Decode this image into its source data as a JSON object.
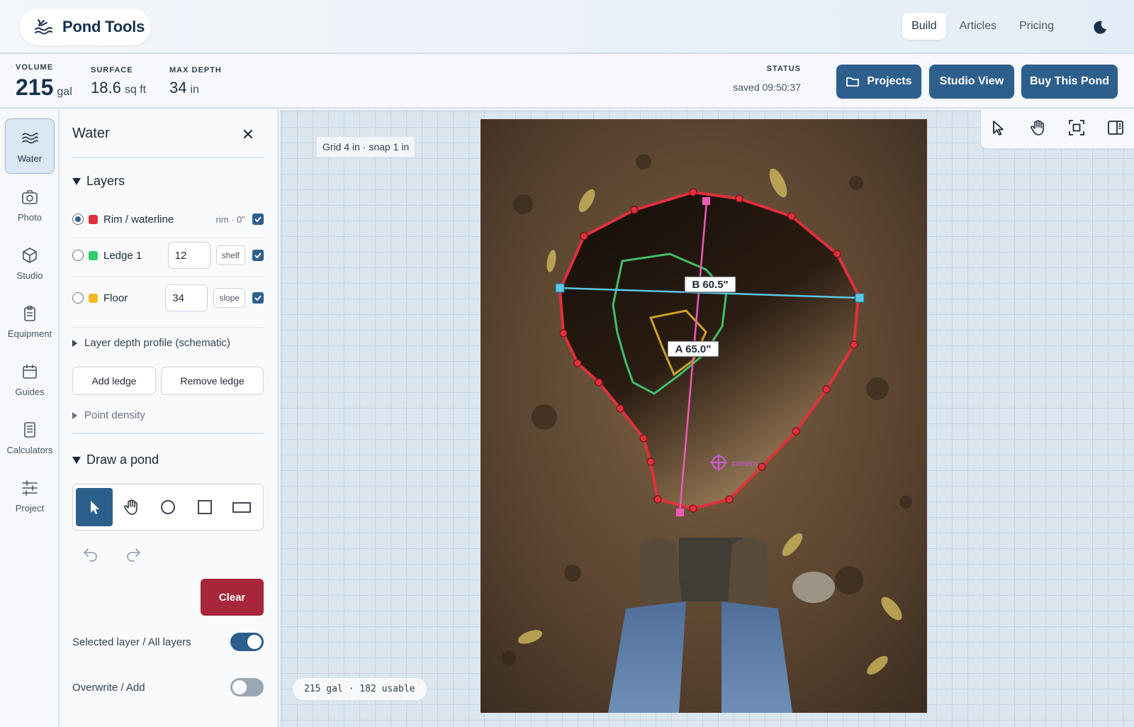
{
  "brand": {
    "name": "Pond Tools",
    "icon": "pond-waves-logo"
  },
  "nav": {
    "items": [
      "Build",
      "Articles",
      "Pricing"
    ],
    "active": "Build",
    "theme_icon": "moon-icon"
  },
  "stats": {
    "volume": {
      "label": "VOLUME",
      "value": "215",
      "unit": "gal"
    },
    "surface": {
      "label": "SURFACE",
      "value": "18.6",
      "unit": "sq ft"
    },
    "max_depth": {
      "label": "MAX DEPTH",
      "value": "34",
      "unit": "in"
    },
    "status": {
      "label": "STATUS",
      "value": "saved 09:50:37"
    }
  },
  "actions": {
    "projects": "Projects",
    "studio": "Studio View",
    "buy": "Buy This Pond"
  },
  "rail": [
    {
      "label": "Water",
      "icon": "waves-icon"
    },
    {
      "label": "Photo",
      "icon": "camera-icon"
    },
    {
      "label": "Studio",
      "icon": "cube-icon"
    },
    {
      "label": "Equipment",
      "icon": "clipboard-icon"
    },
    {
      "label": "Guides",
      "icon": "calendar-icon"
    },
    {
      "label": "Calculators",
      "icon": "calculator-icon"
    },
    {
      "label": "Project",
      "icon": "sliders-icon"
    }
  ],
  "panel": {
    "title": "Water",
    "layers_heading": "Layers",
    "layers": [
      {
        "name": "Rim / waterline",
        "color": "#e0313b",
        "meta": "rim · 0\"",
        "selected": true,
        "visible": true
      },
      {
        "name": "Ledge 1",
        "color": "#2fcf6a",
        "depth": "12",
        "kind": "shelf",
        "selected": false,
        "visible": true
      },
      {
        "name": "Floor",
        "color": "#f5b820",
        "depth": "34",
        "kind": "slope",
        "selected": false,
        "visible": true
      }
    ],
    "depth_profile": "Layer depth profile (schematic)",
    "add_ledge": "Add ledge",
    "remove_ledge": "Remove ledge",
    "point_density": "Point density",
    "draw_heading": "Draw a pond",
    "draw_tools": [
      "pointer-tool",
      "hand-tool",
      "circle-tool",
      "square-tool",
      "rectangle-tool"
    ],
    "active_tool": "pointer-tool",
    "clear": "Clear",
    "toggle_scope": {
      "label": "Selected layer / All layers",
      "on": true
    },
    "toggle_mode": {
      "label": "Overwrite / Add",
      "on": false
    }
  },
  "canvas": {
    "grid_label": "Grid 4 in · snap 1 in",
    "usage_label": "215 gal · 182 usable",
    "measure_a": "A  65.0\"",
    "measure_b": "B  60.5\"",
    "camera_label": "camera",
    "float_tools": [
      "select-icon",
      "pan-hand-icon",
      "fit-view-icon",
      "panel-toggle-icon"
    ]
  },
  "colors": {
    "accent": "#2d5f8c",
    "danger": "#a8263a",
    "rim": "#e0313b",
    "ledge": "#2fcf6a",
    "floor": "#c9a227",
    "measure_a": "#ee5ab8",
    "measure_b": "#5cc8e8"
  }
}
